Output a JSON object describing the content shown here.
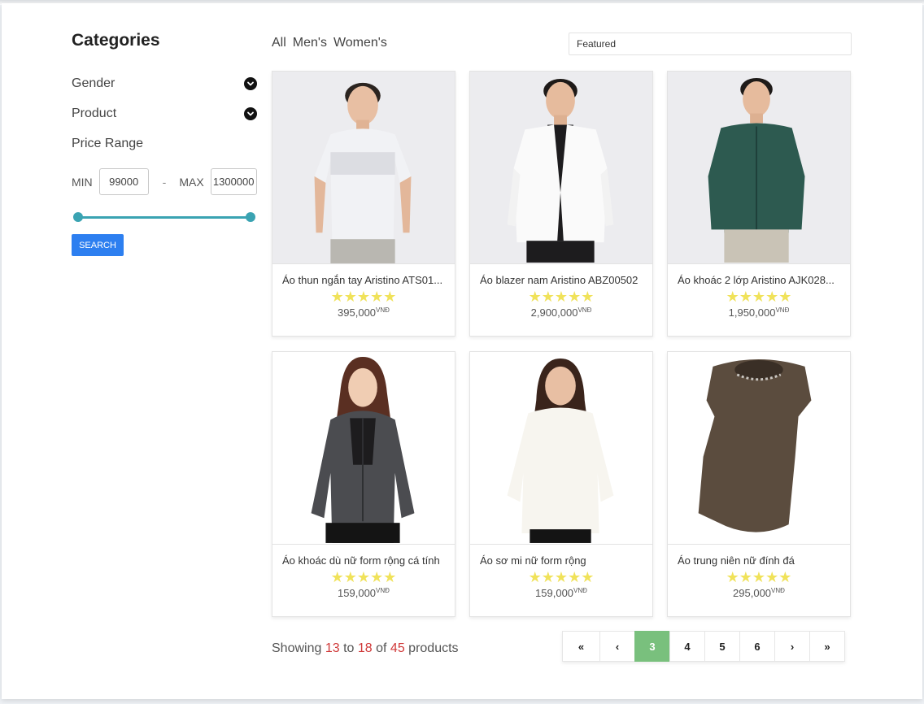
{
  "sidebar": {
    "title": "Categories",
    "filters": [
      {
        "label": "Gender",
        "icon": "chevron-down-circle-icon"
      },
      {
        "label": "Product",
        "icon": "chevron-down-circle-icon"
      }
    ],
    "price_range_label": "Price Range",
    "min_label": "MIN",
    "min_value": "99000",
    "dash": "-",
    "max_label": "MAX",
    "max_value": "1300000",
    "slider": {
      "low_fraction": 0.0,
      "high_fraction": 1.0,
      "color": "#3aa3b2"
    },
    "search_label": "SEARCH"
  },
  "tabs": [
    "All",
    "Men's",
    "Women's"
  ],
  "sort": {
    "selected": "Featured"
  },
  "products": [
    {
      "name": "Áo thun ngắn tay Aristino ATS01...",
      "rating": "★★★★★",
      "price": "395,000",
      "currency": "VNĐ"
    },
    {
      "name": "Áo blazer nam Aristino ABZ00502",
      "rating": "★★★★★",
      "price": "2,900,000",
      "currency": "VNĐ"
    },
    {
      "name": "Áo khoác 2 lớp Aristino AJK028...",
      "rating": "★★★★★",
      "price": "1,950,000",
      "currency": "VNĐ"
    },
    {
      "name": "Áo khoác dù nữ form rộng cá tính",
      "rating": "★★★★★",
      "price": "159,000",
      "currency": "VNĐ"
    },
    {
      "name": "Áo sơ mi nữ form rộng",
      "rating": "★★★★★",
      "price": "159,000",
      "currency": "VNĐ"
    },
    {
      "name": "Áo trung niên nữ đính đá",
      "rating": "★★★★★",
      "price": "295,000",
      "currency": "VNĐ"
    }
  ],
  "showing": {
    "prefix": "Showing",
    "from": "13",
    "to_word": "to",
    "to": "18",
    "of_word": "of",
    "total": "45",
    "suffix": "products"
  },
  "pagination": {
    "first": "«",
    "prev": "‹",
    "pages": [
      "3",
      "4",
      "5",
      "6"
    ],
    "active": "3",
    "next": "›",
    "last": "»"
  },
  "colors": {
    "accent": "#2d7ff0",
    "active_page": "#79c07d",
    "star": "#f0e25a",
    "highlight": "#d03a3a"
  }
}
